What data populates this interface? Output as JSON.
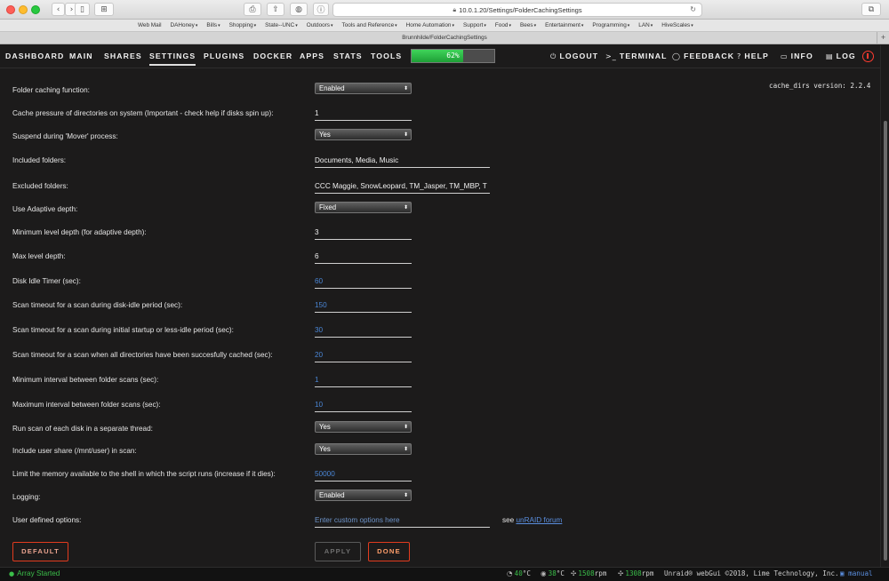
{
  "browser": {
    "url": "10.0.1.20/Settings/FolderCachingSettings",
    "tab_title": "Brunnhilde/FolderCachingSettings",
    "favorites": [
      {
        "label": "Web Mail",
        "menu": false
      },
      {
        "label": "DAHoney",
        "menu": true
      },
      {
        "label": "Bills",
        "menu": true
      },
      {
        "label": "Shopping",
        "menu": true
      },
      {
        "label": "State--UNC",
        "menu": true
      },
      {
        "label": "Outdoors",
        "menu": true
      },
      {
        "label": "Tools and Reference",
        "menu": true
      },
      {
        "label": "Home Automation",
        "menu": true
      },
      {
        "label": "Support",
        "menu": true
      },
      {
        "label": "Food",
        "menu": true
      },
      {
        "label": "Bees",
        "menu": true
      },
      {
        "label": "Entertainment",
        "menu": true
      },
      {
        "label": "Programming",
        "menu": true
      },
      {
        "label": "LAN",
        "menu": true
      },
      {
        "label": "HiveScales",
        "menu": true
      }
    ],
    "fav_chevron": "▾",
    "new_tab": "+"
  },
  "nav": {
    "items": [
      "DASHBOARD",
      "MAIN",
      "SHARES",
      "SETTINGS",
      "PLUGINS",
      "DOCKER",
      "APPS",
      "STATS",
      "TOOLS"
    ],
    "active": "SETTINGS",
    "cpu_percent": 62,
    "cpu_label": "62%",
    "right": [
      {
        "icon": "logout-icon",
        "glyph": "⏻",
        "label": "LOGOUT"
      },
      {
        "icon": "terminal-icon",
        "glyph": ">_",
        "label": "TERMINAL"
      },
      {
        "icon": "feedback-icon",
        "glyph": "◯",
        "label": "FEEDBACK"
      },
      {
        "icon": "help-icon",
        "glyph": "?",
        "label": "HELP"
      },
      {
        "icon": "info-icon",
        "glyph": "▭",
        "label": "INFO"
      },
      {
        "icon": "log-icon",
        "glyph": "▤",
        "label": "LOG"
      }
    ]
  },
  "form": {
    "version": "cache_dirs version: 2.2.4",
    "fields": [
      {
        "label": "Folder caching function:",
        "type": "select",
        "value": "Enabled"
      },
      {
        "label": "Cache pressure of directories on system (Important - check help if disks spin up):",
        "type": "input",
        "value": "1"
      },
      {
        "label": "Suspend during 'Mover' process:",
        "type": "select",
        "value": "Yes"
      },
      {
        "label": "Included folders:",
        "type": "wide",
        "value": "Documents, Media, Music"
      },
      {
        "label": "Excluded folders:",
        "type": "wide",
        "value": "CCC Maggie, SnowLeopard, TM_Jasper, TM_MBP, T"
      },
      {
        "label": "Use Adaptive depth:",
        "type": "select",
        "value": "Fixed"
      },
      {
        "label": "Minimum level depth (for adaptive depth):",
        "type": "input",
        "value": "3"
      },
      {
        "label": "Max level depth:",
        "type": "input",
        "value": "6"
      },
      {
        "label": "Disk Idle Timer (sec):",
        "type": "input-blue",
        "value": "60"
      },
      {
        "label": "Scan timeout for a scan during disk-idle period (sec):",
        "type": "input-blue",
        "value": "150"
      },
      {
        "label": "Scan timeout for a scan during initial startup or less-idle period (sec):",
        "type": "input-blue",
        "value": "30"
      },
      {
        "label": "Scan timeout for a scan when all directories have been succesfully cached (sec):",
        "type": "input-blue",
        "value": "20"
      },
      {
        "label": "Minimum interval between folder scans (sec):",
        "type": "input-blue",
        "value": "1"
      },
      {
        "label": "Maximum interval between folder scans (sec):",
        "type": "input-blue",
        "value": "10"
      },
      {
        "label": "Run scan of each disk in a separate thread:",
        "type": "select",
        "value": "Yes"
      },
      {
        "label": "Include user share (/mnt/user) in scan:",
        "type": "select",
        "value": "Yes"
      },
      {
        "label": "Limit the memory available to the shell in which the script runs (increase if it dies):",
        "type": "input-blue",
        "value": "50000"
      },
      {
        "label": "Logging:",
        "type": "select",
        "value": "Enabled"
      },
      {
        "label": "User defined options:",
        "type": "placeholder",
        "value": "Enter custom options here"
      }
    ],
    "see_text": "see",
    "forum_link": "unRAID forum",
    "buttons": {
      "default": "DEFAULT",
      "apply": "APPLY",
      "done": "DONE"
    }
  },
  "footer": {
    "status": "Array Started",
    "cpu_temp": "40",
    "mb_temp": "38",
    "temp_unit": "°C",
    "fan1": "1508",
    "fan2": "1308",
    "fan_unit": "rpm",
    "copyright": "Unraid® webGui ©2018, Lime Technology, Inc.",
    "manual": "manual"
  }
}
